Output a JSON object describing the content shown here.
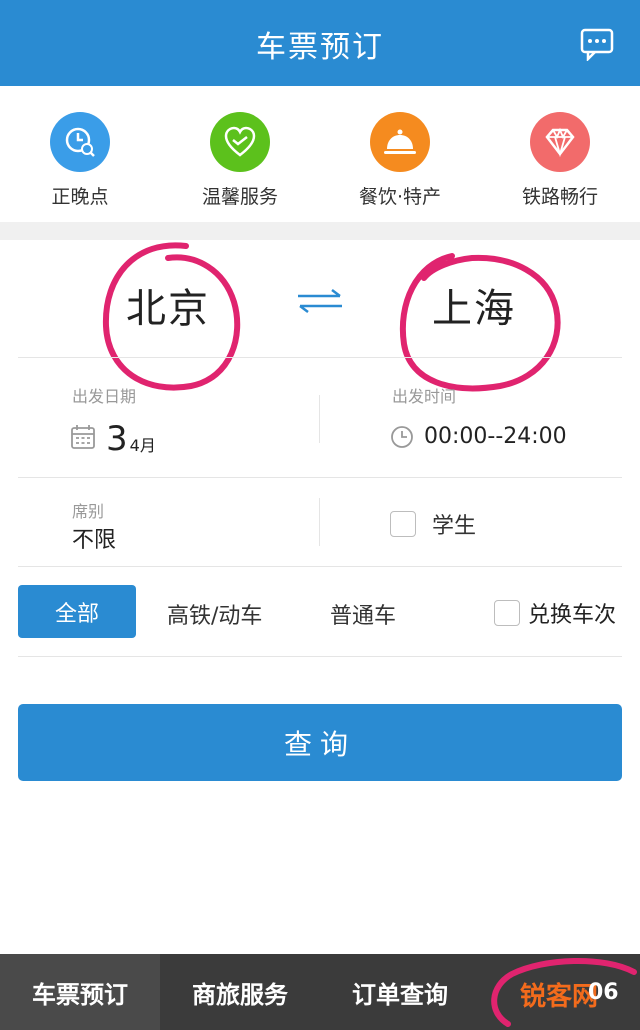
{
  "header": {
    "title": "车票预订",
    "message_icon": "message-icon"
  },
  "quick_links": [
    {
      "label": "正晚点",
      "icon": "clock-search-icon",
      "color": "#3a9de8"
    },
    {
      "label": "温馨服务",
      "icon": "heart-handshake-icon",
      "color": "#5cc11c"
    },
    {
      "label": "餐饮·特产",
      "icon": "food-cloche-icon",
      "color": "#f58b1f"
    },
    {
      "label": "铁路畅行",
      "icon": "diamond-icon",
      "color": "#f26b6b"
    }
  ],
  "route": {
    "from": "北京",
    "to": "上海",
    "swap_icon": "swap-arrows-icon"
  },
  "depart_date": {
    "label": "出发日期",
    "day": "3",
    "month": "4月"
  },
  "depart_time": {
    "label": "出发时间",
    "range": "00:00--24:00"
  },
  "seat": {
    "label": "席别",
    "value": "不限"
  },
  "student": {
    "label": "学生",
    "checked": false
  },
  "train_types": {
    "all": "全部",
    "high_speed": "高铁/动车",
    "normal": "普通车"
  },
  "exchange": {
    "label": "兑换车次",
    "checked": false
  },
  "search_button": "查询",
  "tabs": [
    {
      "label": "车票预订",
      "active": true
    },
    {
      "label": "商旅服务",
      "active": false
    },
    {
      "label": "订单查询",
      "active": false
    },
    {
      "label": "我的12306",
      "active": false
    }
  ],
  "watermark": {
    "brand": "锐客网",
    "suffix": "06"
  },
  "colors": {
    "primary": "#2a8bd2",
    "tabbar": "#3b3b3b",
    "annotation": "#e0246f"
  }
}
